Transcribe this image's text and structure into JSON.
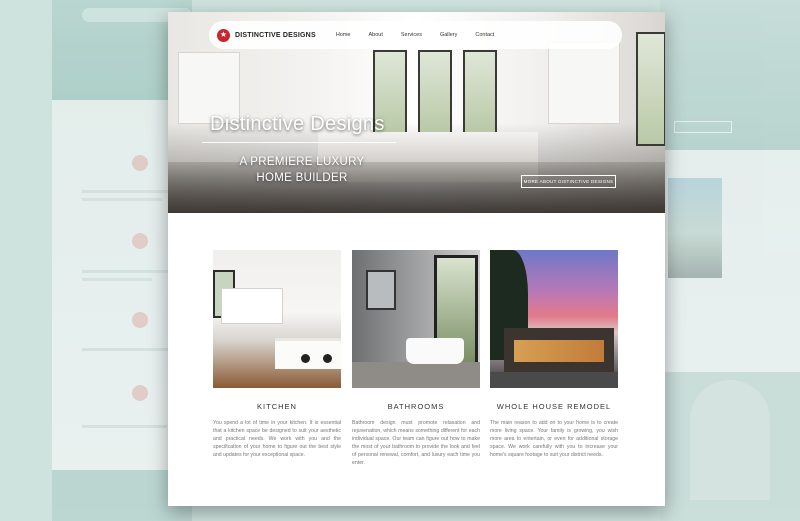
{
  "site": {
    "logo_text": "DISTINCTIVE DESIGNS",
    "logo_icon": "star-logo-icon",
    "nav": [
      "Home",
      "About",
      "Services",
      "Gallery",
      "Contact"
    ]
  },
  "hero": {
    "title": "Distinctive Designs",
    "subtitle": "A PREMIERE LUXURY HOME BUILDER",
    "button_label": "MORE ABOUT DISTINCTIVE DESIGNS"
  },
  "features": [
    {
      "title": "KITCHEN",
      "text": "You spend a lot of time in your kitchen. It is essential that a kitchen space be designed to suit your aesthetic and practical needs. We work with you and the specification of your home to figure out the best style and updates for your exceptional space."
    },
    {
      "title": "BATHROOMS",
      "text": "Bathroom design must promote relaxation and rejuvenation, which means something different for each individual space. Our team can figure out how to make the most of your bathroom to provide the look and feel of personal renewal, comfort, and luxury each time you enter."
    },
    {
      "title": "WHOLE HOUSE REMODEL",
      "text": "The main reason to add on to your home is to create more living space. Your family is growing, you wish more area to entertain, or even for additional storage space. We work carefully with you to increase your home's square footage to suit your district needs."
    }
  ],
  "colors": {
    "accent_red": "#c7262c",
    "background_teal": "#cfe3de"
  }
}
